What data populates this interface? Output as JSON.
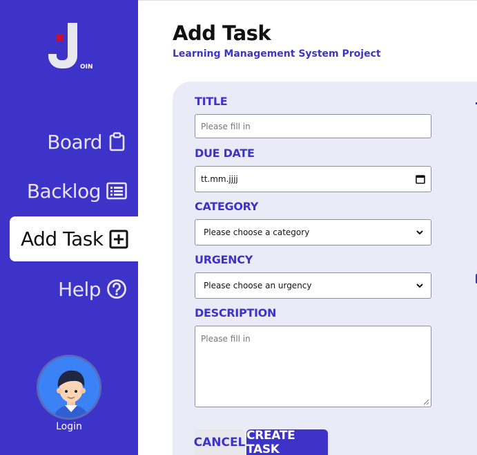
{
  "sidebar": {
    "logo_text": "OIN",
    "items": [
      {
        "label": "Board",
        "icon": "clipboard-icon"
      },
      {
        "label": "Backlog",
        "icon": "list-icon"
      },
      {
        "label": "Add Task",
        "icon": "plus-square-icon",
        "active": true
      },
      {
        "label": "Help",
        "icon": "question-circle-icon"
      }
    ],
    "login_label": "Login"
  },
  "header": {
    "title": "Add Task",
    "subtitle": "Learning Management System Project"
  },
  "form": {
    "title_label": "TITLE",
    "title_placeholder": "Please fill in",
    "due_date_label": "DUE DATE",
    "due_date_value": "tt.mm.jjjj",
    "category_label": "CATEGORY",
    "category_selected": "Please choose a category",
    "urgency_label": "URGENCY",
    "urgency_selected": "Please choose an urgency",
    "description_label": "DESCRIPTION",
    "description_placeholder": "Please fill in"
  },
  "actions": {
    "cancel_label": "CANCEL",
    "create_label": "CREATE TASK"
  },
  "colors": {
    "brand": "#3d33c8",
    "form_background": "#ebebf8",
    "logo_accent": "#c8102e",
    "logo_letter": "#e8e8ee"
  }
}
